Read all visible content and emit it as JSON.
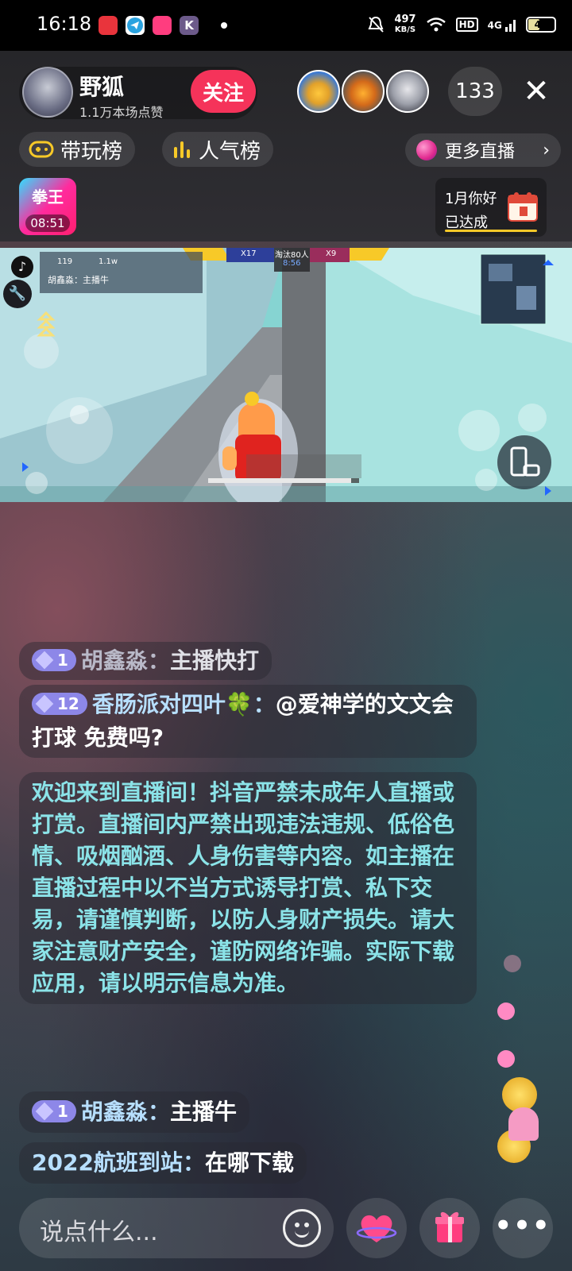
{
  "status_bar": {
    "time": "16:18",
    "net_speed_value": "497",
    "net_speed_unit": "KB/S",
    "hd_label": "HD",
    "signal_label": "4G",
    "battery": "46"
  },
  "host": {
    "name": "野狐",
    "likes": "1.1万本场点赞",
    "follow_label": "关注"
  },
  "viewers": {
    "count": "133"
  },
  "rank_tabs": [
    {
      "label": "带玩榜"
    },
    {
      "label": "人气榜"
    }
  ],
  "more_live": {
    "label": "更多直播"
  },
  "badge": {
    "title": "拳王",
    "time": "08:51"
  },
  "task": {
    "line1": "1月你好",
    "line2": "已达成"
  },
  "game_hud": {
    "team_left": "X17",
    "team_right": "X9",
    "center_top": "淘汰80人",
    "center_time": "8:56",
    "chat_line": "胡鑫淼：主播牛",
    "stat_1": "119",
    "stat_2": "1.1w"
  },
  "chat": [
    {
      "level": "1",
      "user": "胡鑫淼",
      "sep": "：",
      "text": "主播快打"
    },
    {
      "level": "12",
      "user": "香肠派对四叶🍀",
      "sep": "：",
      "text": "@爱神学的文文会打球 免费吗?"
    },
    {
      "system": "欢迎来到直播间！抖音严禁未成年人直播或打赏。直播间内严禁出现违法违规、低俗色情、吸烟酗酒、人身伤害等内容。如主播在直播过程中以不当方式诱导打赏、私下交易，请谨慎判断，以防人身财产损失。请大家注意财产安全，谨防网络诈骗。实际下载应用，请以明示信息为准。"
    },
    {
      "level": "1",
      "user": "胡鑫淼",
      "sep": "：",
      "text": "主播牛"
    },
    {
      "user": "2022航班到站",
      "sep": "：",
      "text": "在哪下载"
    }
  ],
  "input": {
    "placeholder": "说点什么..."
  },
  "colors": {
    "follow": "#f5335a",
    "system_text": "#8be3e8",
    "rank_icon": "#f7c928",
    "level_badge": "#8d87e8"
  }
}
